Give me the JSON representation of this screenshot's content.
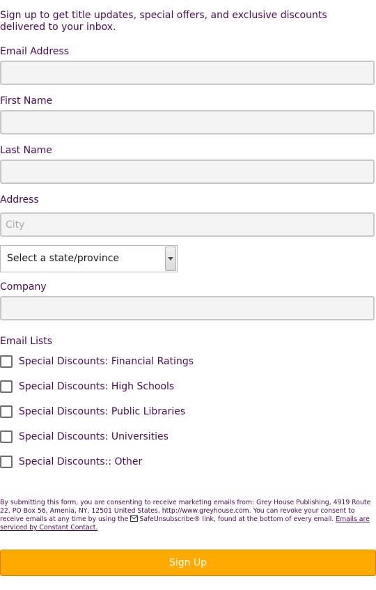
{
  "intro": "Sign up to get title updates, special offers, and exclusive discounts delivered to your inbox.",
  "fields": {
    "email_label": "Email Address",
    "first_name_label": "First Name",
    "last_name_label": "Last Name",
    "address_label": "Address",
    "city_placeholder": "City",
    "state_select_value": "Select a state/province",
    "company_label": "Company"
  },
  "email_lists": {
    "heading": "Email Lists",
    "items": [
      {
        "label": "Special Discounts: Financial Ratings"
      },
      {
        "label": "Special Discounts: High Schools"
      },
      {
        "label": "Special Discounts: Public Libraries"
      },
      {
        "label": "Special Discounts: Universities"
      },
      {
        "label": "Special Discounts:: Other"
      }
    ]
  },
  "legal": {
    "text_1": "By submitting this form, you are consenting to receive marketing emails from: Grey House Publishing, 4919 Route 22, PO Box 56, Amenia, NY, 12501 United States, http://www.greyhouse.com. You can revoke your consent to receive emails at any time by using the ",
    "safeunsubscribe": "SafeUnsubscribe®",
    "text_2": " link, found at the bottom of every email. ",
    "link": "Emails are serviced by Constant Contact.",
    "icon": "envelope-icon"
  },
  "signup_label": "Sign Up",
  "colors": {
    "text": "#4a0a56",
    "button": "#ffaa00",
    "field_bg": "#f4f4f4"
  }
}
